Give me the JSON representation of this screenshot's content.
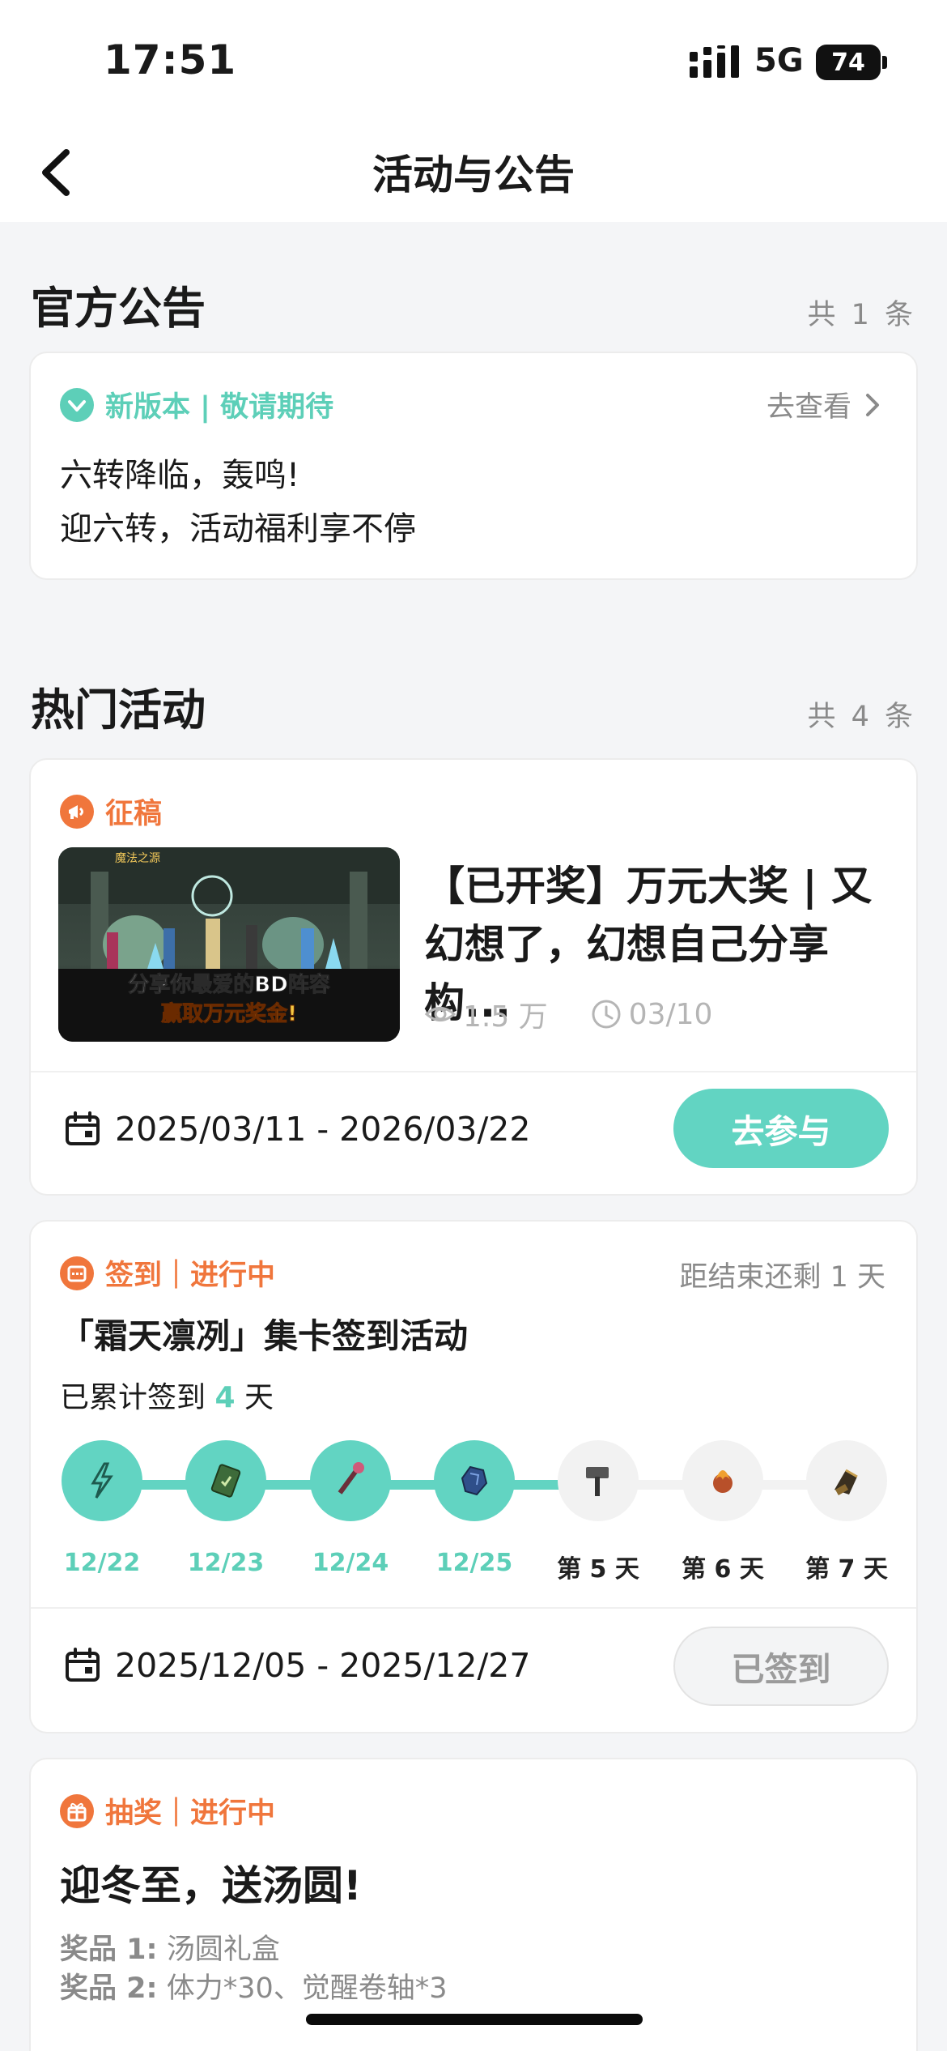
{
  "status_bar": {
    "time": "17:51",
    "network": "5G",
    "battery": "74"
  },
  "nav": {
    "title": "活动与公告"
  },
  "announcements": {
    "title": "官方公告",
    "count": "共 1 条",
    "item": {
      "tag": "新版本 | 敬请期待",
      "link": "去查看",
      "line1": "六转降临，轰鸣!",
      "line2": "迎六转，活动福利享不停"
    }
  },
  "hot": {
    "title": "热门活动",
    "count": "共 4 条",
    "event1": {
      "tag": "征稿",
      "title": "【已开奖】万元大奖 | 又幻想了，幻想自己分享构...",
      "views": "1.5 万",
      "date": "03/10",
      "range": "2025/03/11 - 2026/03/22",
      "button": "去参与",
      "banner_line1": "分享你最爱的BD阵容",
      "banner_line2": "赢取万元奖金!",
      "banner_logo": "魔法之源"
    },
    "event2": {
      "tag": "签到｜进行中",
      "remain": "距结束还剩 1 天",
      "title": "「霜天凛冽」集卡签到活动",
      "progress_prefix": "已累计签到",
      "progress_num": "4",
      "progress_suffix": "天",
      "days": [
        {
          "label": "12/22",
          "done": true,
          "icon": "lightning-icon"
        },
        {
          "label": "12/23",
          "done": true,
          "icon": "green-card-icon"
        },
        {
          "label": "12/24",
          "done": true,
          "icon": "staff-icon"
        },
        {
          "label": "12/25",
          "done": true,
          "icon": "blue-ore-icon"
        },
        {
          "label": "第 5 天",
          "done": false,
          "icon": "hammer-icon"
        },
        {
          "label": "第 6 天",
          "done": false,
          "icon": "fire-orb-icon"
        },
        {
          "label": "第 7 天",
          "done": false,
          "icon": "gauntlet-icon"
        }
      ],
      "range": "2025/12/05 - 2025/12/27",
      "button": "已签到"
    },
    "event3": {
      "tag": "抽奖｜进行中",
      "title": "迎冬至，送汤圆!",
      "prize1_label": "奖品 1:",
      "prize1_value": "汤圆礼盒",
      "prize2_label": "奖品 2:",
      "prize2_value": "体力*30、觉醒卷轴*3"
    }
  },
  "colors": {
    "accent": "#62d4c2",
    "orange": "#f0763c",
    "muted": "#8a8a8a"
  }
}
